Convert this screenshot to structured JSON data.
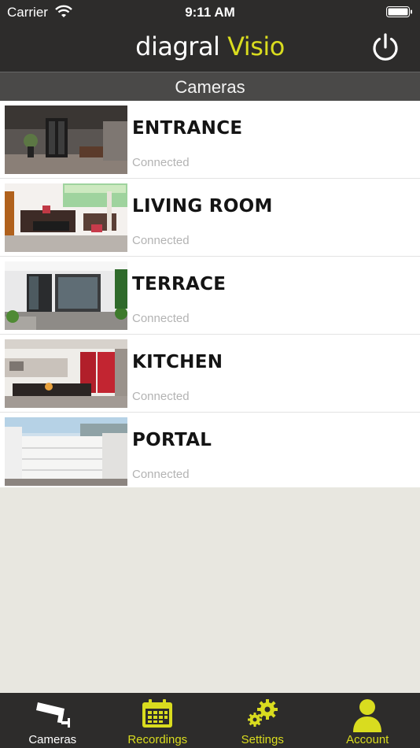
{
  "status_bar": {
    "carrier": "Carrier",
    "time": "9:11 AM"
  },
  "header": {
    "brand": "diagral",
    "product": "Visio"
  },
  "section": {
    "title": "Cameras"
  },
  "cameras": [
    {
      "name": "ENTRANCE",
      "status": "Connected"
    },
    {
      "name": "LIVING ROOM",
      "status": "Connected"
    },
    {
      "name": "TERRACE",
      "status": "Connected"
    },
    {
      "name": "KITCHEN",
      "status": "Connected"
    },
    {
      "name": "PORTAL",
      "status": "Connected"
    }
  ],
  "tabs": [
    {
      "label": "Cameras",
      "icon": "camera-icon",
      "active": true
    },
    {
      "label": "Recordings",
      "icon": "calendar-icon",
      "active": false
    },
    {
      "label": "Settings",
      "icon": "gears-icon",
      "active": false
    },
    {
      "label": "Account",
      "icon": "user-icon",
      "active": false
    }
  ],
  "colors": {
    "accent": "#d9dc1f",
    "bar": "#2d2c2b",
    "section": "#4a4948",
    "background": "#e8e7e0"
  }
}
